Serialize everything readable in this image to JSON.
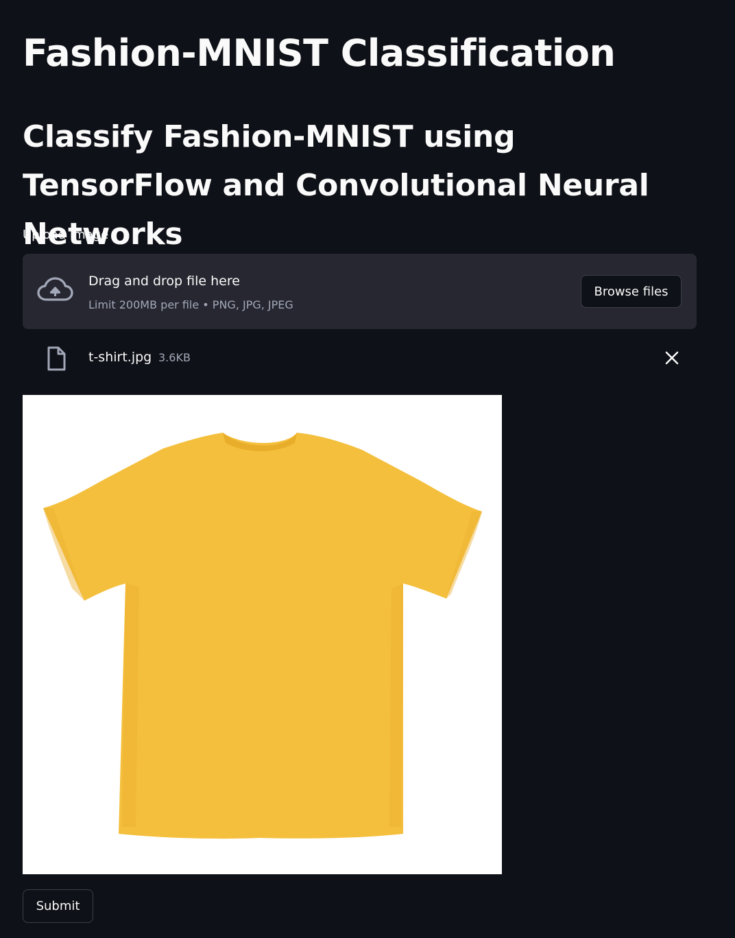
{
  "header": {
    "title": "Fashion-MNIST Classification",
    "subtitle": "Classify Fashion-MNIST using TensorFlow and Convolutional Neural Networks"
  },
  "uploader": {
    "label": "Upload Image",
    "drop_title": "Drag and drop file here",
    "drop_limit": "Limit 200MB per file • PNG, JPG, JPEG",
    "browse_label": "Browse files",
    "cloud_icon": "cloud-upload-icon"
  },
  "uploaded_file": {
    "name": "t-shirt.jpg",
    "size": "3.6KB",
    "file_icon": "file-icon",
    "remove_icon": "close-icon"
  },
  "preview": {
    "subject": "t-shirt-image",
    "shirt_color": "#f4bf3c",
    "shadow_color": "#e8ad2a",
    "background_color": "#ffffff"
  },
  "actions": {
    "submit_label": "Submit"
  },
  "theme": {
    "background": "#0e1117",
    "surface": "#262730",
    "text": "#fafafa",
    "muted_text": "#a3a8b8",
    "border": "#3d4048"
  }
}
